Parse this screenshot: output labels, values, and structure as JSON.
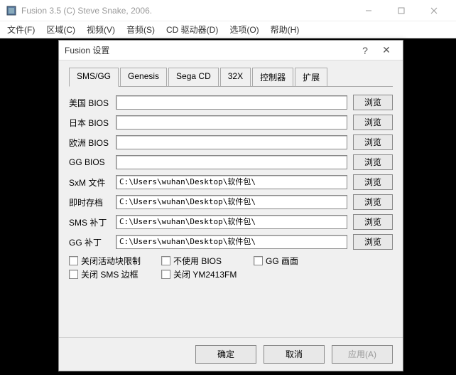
{
  "window": {
    "title": "Fusion 3.5 (C) Steve Snake, 2006."
  },
  "menu": {
    "file": "文件(F)",
    "region": "区域(C)",
    "video": "视频(V)",
    "audio": "音频(S)",
    "cd": "CD 驱动器(D)",
    "options": "选项(O)",
    "help": "帮助(H)"
  },
  "dialog": {
    "title": "Fusion 设置",
    "tabs": {
      "smsgg": "SMS/GG",
      "genesis": "Genesis",
      "segacd": "Sega CD",
      "32x": "32X",
      "controller": "控制器",
      "extend": "扩展"
    },
    "labels": {
      "us_bios": "美国 BIOS",
      "jp_bios": "日本 BIOS",
      "eu_bios": "欧洲 BIOS",
      "gg_bios": "GG BIOS",
      "sxm": "SxM 文件",
      "save": "即时存档",
      "sms_patch": "SMS 补丁",
      "gg_patch": "GG 补丁"
    },
    "values": {
      "us_bios": "",
      "jp_bios": "",
      "eu_bios": "",
      "gg_bios": "",
      "sxm": "C:\\Users\\wuhan\\Desktop\\软件包\\",
      "save": "C:\\Users\\wuhan\\Desktop\\软件包\\",
      "sms_patch": "C:\\Users\\wuhan\\Desktop\\软件包\\",
      "gg_patch": "C:\\Users\\wuhan\\Desktop\\软件包\\"
    },
    "browse": "浏览",
    "checks": {
      "close_active_limit": "关闭活动块限制",
      "no_bios": "不使用 BIOS",
      "gg_screen": "GG 画面",
      "close_sms_border": "关闭 SMS 边框",
      "close_ym2413": "关闭 YM2413FM"
    },
    "buttons": {
      "ok": "确定",
      "cancel": "取消",
      "apply": "应用(A)"
    }
  }
}
